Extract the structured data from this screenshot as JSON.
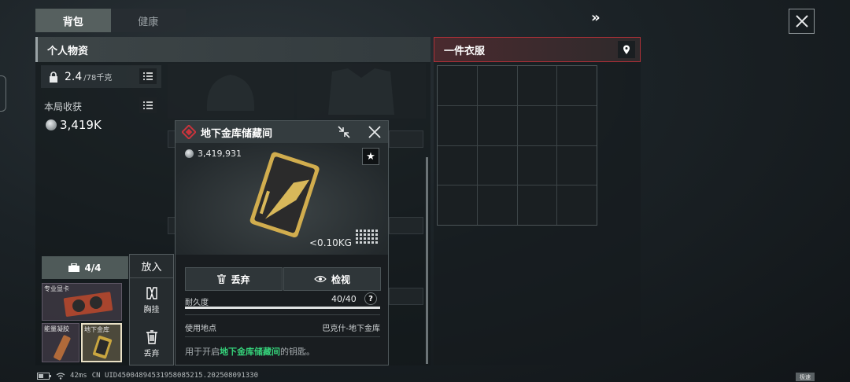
{
  "tabs": [
    {
      "label": "背包",
      "active": true
    },
    {
      "label": "健康",
      "active": false
    }
  ],
  "top": {
    "forward_glyph": "»"
  },
  "personal": {
    "title": "个人物资",
    "weight_value": "2.4",
    "weight_unit": "/78千克",
    "earnings_label": "本局收获",
    "earnings_value": "3,419K"
  },
  "mini_inventory": {
    "tab_count": "4/4",
    "items": [
      {
        "label": "专业显卡"
      },
      {
        "label": "能量凝胶"
      },
      {
        "label": "地下金库"
      }
    ]
  },
  "context_menu": {
    "title": "放入",
    "items": [
      {
        "label": "胸挂",
        "icon": "vest-icon"
      },
      {
        "label": "丢弃",
        "icon": "trash-icon"
      }
    ]
  },
  "clothes": {
    "title": "一件衣服"
  },
  "detail": {
    "title": "地下金库储藏间",
    "price": "3,419,931",
    "weight": "<0.10KG",
    "discard_label": "丢弃",
    "inspect_label": "检视",
    "durability_label": "耐久度",
    "durability_value": "40/40",
    "durability_fraction": 1.0,
    "help_glyph": "?",
    "use_location_label": "使用地点",
    "use_location_value": "巴克什-地下金库",
    "desc_prefix": "用于开启",
    "desc_highlight": "地下金库储藏间",
    "desc_suffix": "的钥匙。",
    "highlight_color": "#35d27a"
  },
  "status_bar": {
    "ping": "42ms",
    "uid": "CN UID450048945319580852​15.202508091330",
    "corner_tag": "极速"
  },
  "colors": {
    "active_tab": "#56605f",
    "clothes_accent": "#b03038",
    "rarity_red": "#c9343c"
  }
}
